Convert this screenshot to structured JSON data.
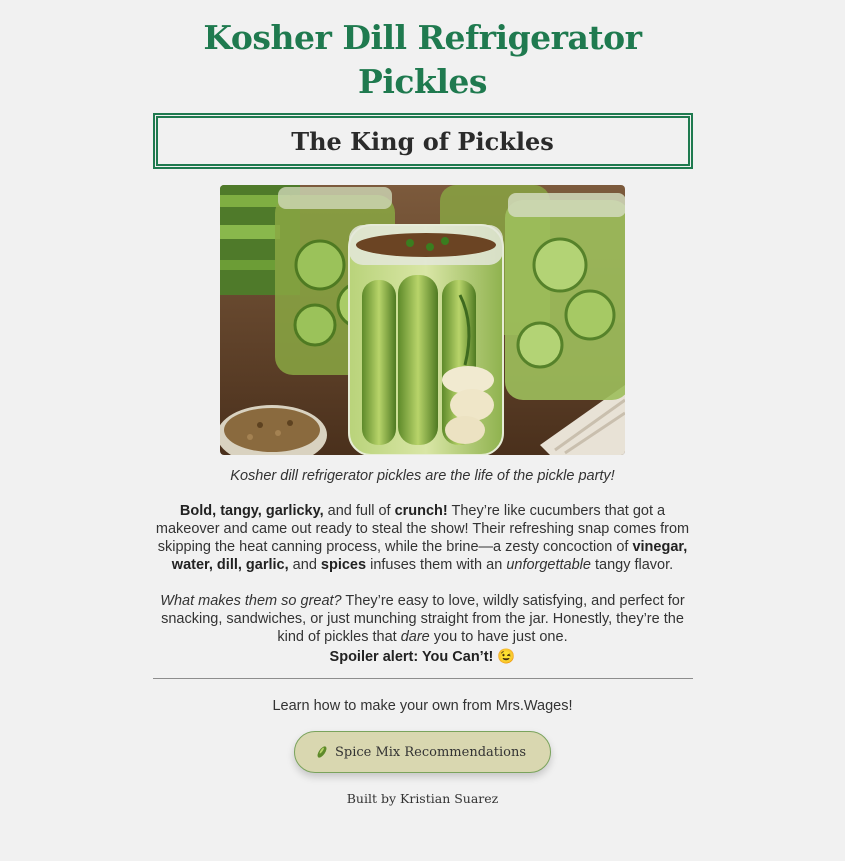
{
  "page": {
    "title": "Kosher Dill Refrigerator Pickles",
    "subtitle": "The King of Pickles",
    "hero_image_caption": "Kosher dill refrigerator pickles are the life of the pickle party!"
  },
  "intro": {
    "bold1": "Bold, tangy, garlicky,",
    "t1": " and full of ",
    "bold2": "crunch!",
    "t2": " They’re like cucumbers that got a makeover and came out ready to steal the show! Their refreshing snap comes from skipping the heat canning process, while the brine—a zesty concoction of ",
    "bold3": "vinegar, water, dill, garlic,",
    "t3": " and ",
    "bold4": "spices",
    "t4": " infuses them with an ",
    "em1": "unforgettable",
    "t5": " tangy flavor."
  },
  "second": {
    "em1": "What makes them so great?",
    "t1": " They’re easy to love, wildly satisfying, and perfect for snacking, sandwiches, or just munching straight from the jar. Honestly, they’re the kind of pickles that ",
    "em2": "dare",
    "t2": " you to have just one."
  },
  "spoiler": "Spoiler alert: You Can’t! 😉",
  "learn": "Learn how to make your own from Mrs.Wages!",
  "button": {
    "icon": "pickle-icon",
    "label": "Spice Mix Recommendations"
  },
  "footer": "Built by Kristian Suarez",
  "colors": {
    "accent": "#1f7a4f",
    "button_bg": "#d9d7b0",
    "button_border": "#7aa35c",
    "background": "#f1f1f1"
  }
}
